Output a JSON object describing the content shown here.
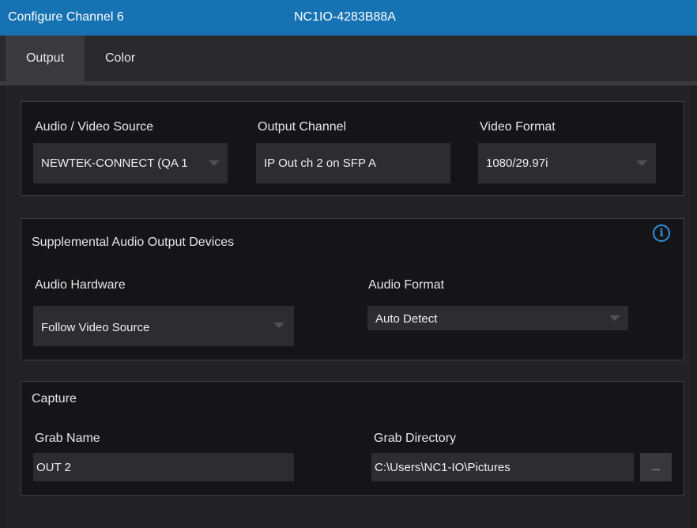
{
  "window": {
    "title": "Configure Channel 6",
    "device_name": "NC1IO-4283B88A"
  },
  "tabs": [
    {
      "label": "Output",
      "active": true
    },
    {
      "label": "Color",
      "active": false
    }
  ],
  "source_section": {
    "av_source": {
      "label": "Audio / Video Source",
      "value": "NEWTEK-CONNECT (QA 1"
    },
    "output_channel": {
      "label": "Output Channel",
      "value": "IP Out ch 2 on SFP A"
    },
    "video_format": {
      "label": "Video Format",
      "value": "1080/29.97i"
    }
  },
  "supplemental_audio": {
    "heading": "Supplemental Audio Output Devices",
    "info_icon": "i",
    "audio_hardware": {
      "label": "Audio Hardware",
      "value": "Follow Video Source"
    },
    "audio_format": {
      "label": "Audio Format",
      "value": "Auto Detect"
    }
  },
  "capture": {
    "heading": "Capture",
    "grab_name": {
      "label": "Grab Name",
      "value": "OUT 2"
    },
    "grab_directory": {
      "label": "Grab Directory",
      "value": "C:\\Users\\NC1-IO\\Pictures"
    },
    "browse_label": "..."
  },
  "colors": {
    "titlebar": "#1672b3",
    "accent_info": "#2f8fe0",
    "panel_bg": "#151517",
    "field_bg": "#2d2d30"
  }
}
